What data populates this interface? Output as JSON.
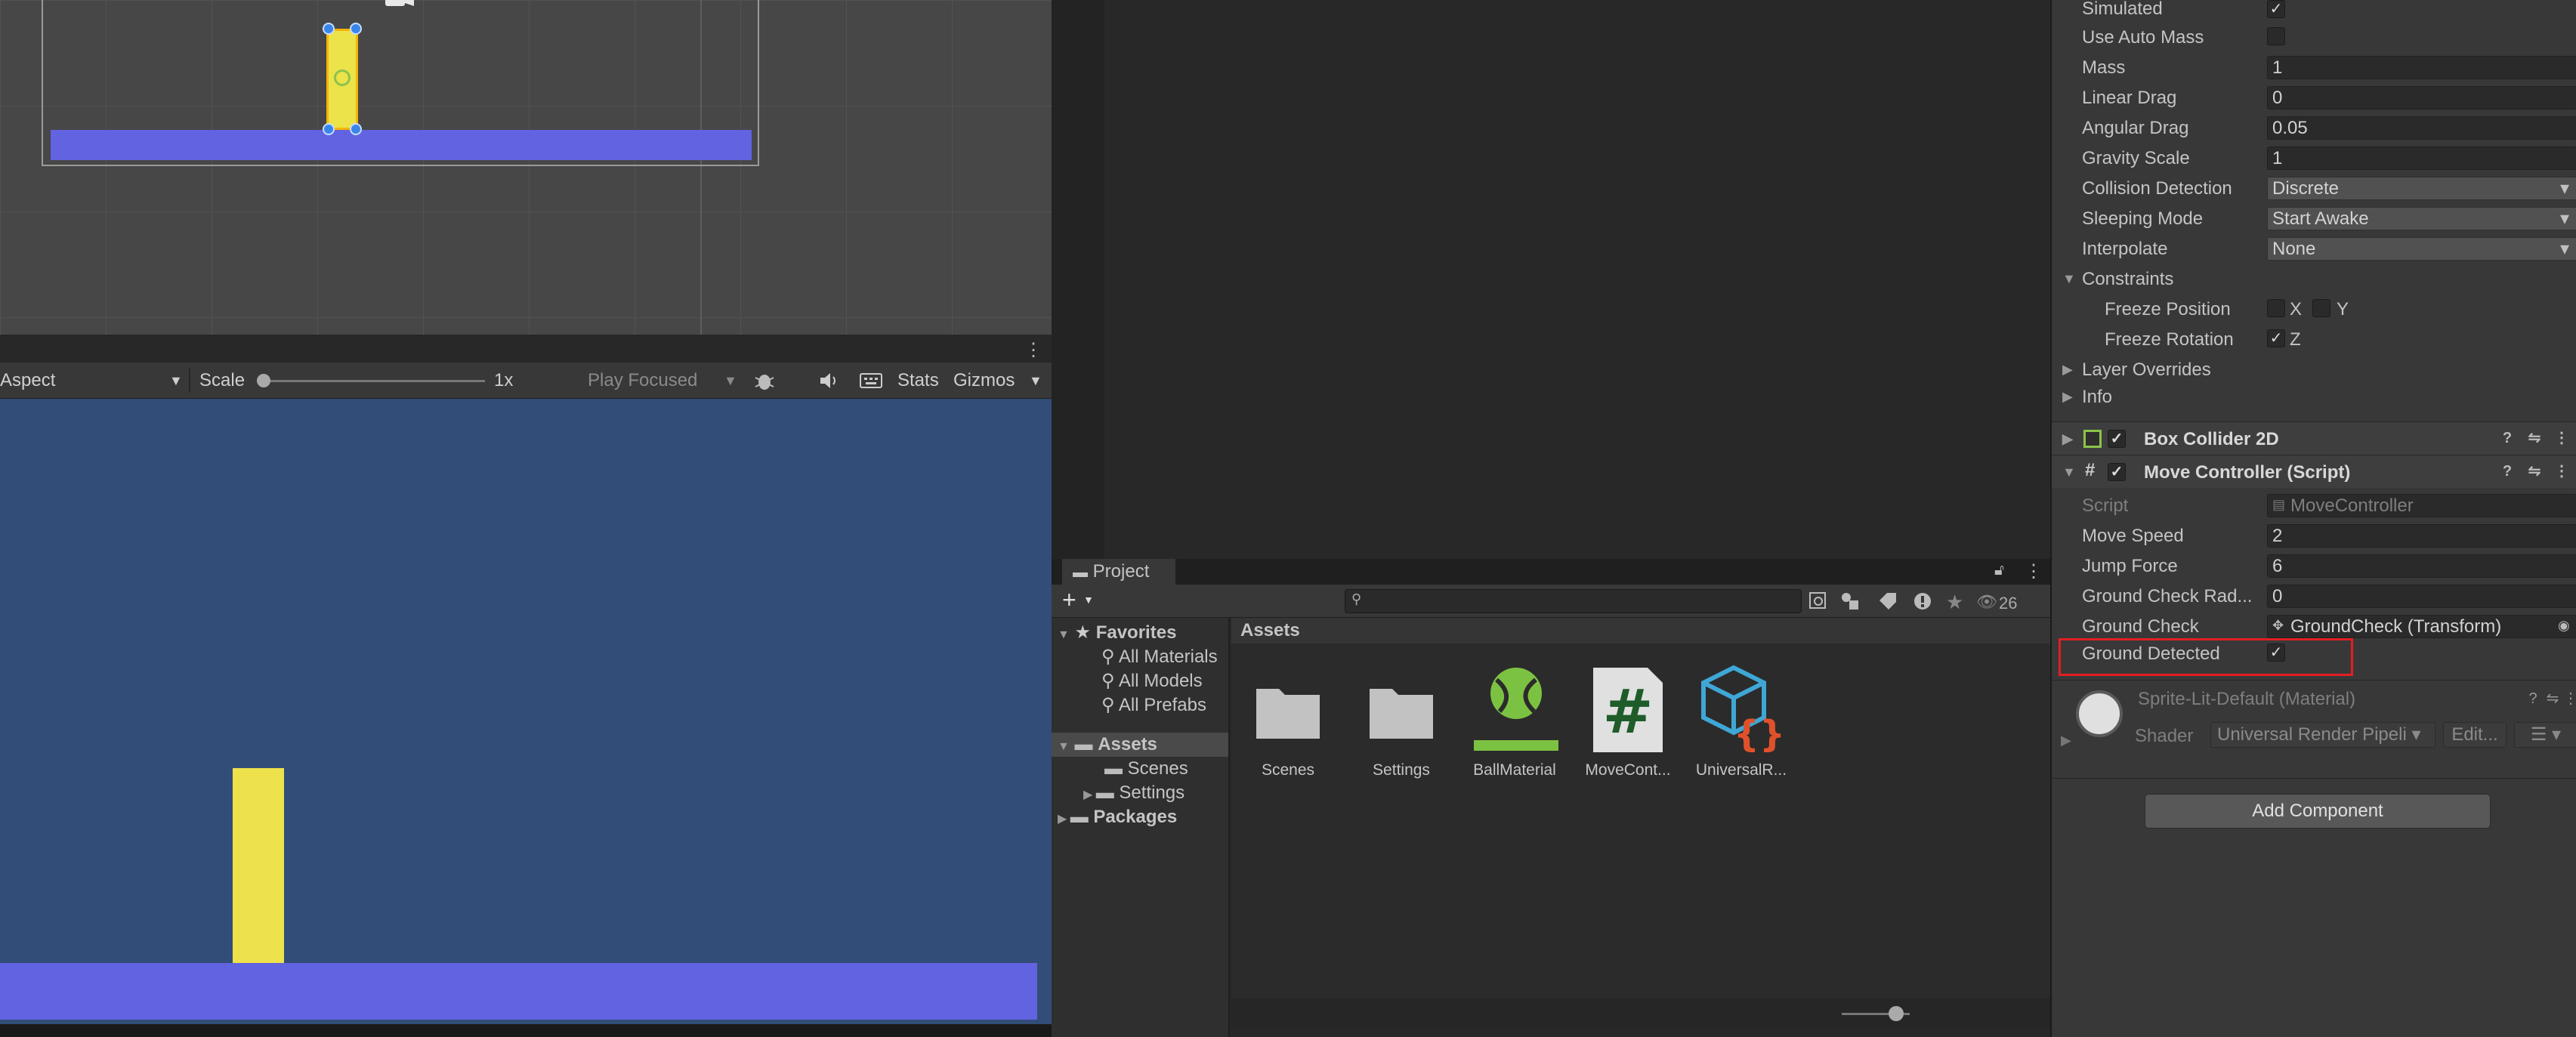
{
  "scene": {
    "camera_icon": "camera-icon"
  },
  "game_toolbar": {
    "aspect": "Aspect",
    "scale_label": "Scale",
    "scale_value": "1x",
    "play_mode": "Play Focused",
    "stats": "Stats",
    "gizmos": "Gizmos"
  },
  "project": {
    "tab": "Project",
    "count": "26",
    "tree": {
      "favorites": "Favorites",
      "all_materials": "All Materials",
      "all_models": "All Models",
      "all_prefabs": "All Prefabs",
      "assets": "Assets",
      "scenes": "Scenes",
      "settings": "Settings",
      "packages": "Packages"
    },
    "assets_header": "Assets",
    "items": [
      {
        "label": "Scenes",
        "icon": "folder-icon"
      },
      {
        "label": "Settings",
        "icon": "folder-icon"
      },
      {
        "label": "BallMaterial",
        "icon": "physics-material-icon"
      },
      {
        "label": "MoveCont...",
        "icon": "csharp-script-icon"
      },
      {
        "label": "UniversalR...",
        "icon": "package-cube-icon"
      }
    ]
  },
  "inspector": {
    "rigidbody": {
      "simulated": "Simulated",
      "use_auto_mass": "Use Auto Mass",
      "mass": "Mass",
      "mass_value": "1",
      "linear_drag": "Linear Drag",
      "linear_drag_value": "0",
      "angular_drag": "Angular Drag",
      "angular_drag_value": "0.05",
      "gravity_scale": "Gravity Scale",
      "gravity_scale_value": "1",
      "collision_detection": "Collision Detection",
      "collision_detection_value": "Discrete",
      "sleeping_mode": "Sleeping Mode",
      "sleeping_mode_value": "Start Awake",
      "interpolate": "Interpolate",
      "interpolate_value": "None",
      "constraints": "Constraints",
      "freeze_position": "Freeze Position",
      "x": "X",
      "y": "Y",
      "freeze_rotation": "Freeze Rotation",
      "z": "Z",
      "layer_overrides": "Layer Overrides",
      "info": "Info"
    },
    "box_collider": "Box Collider 2D",
    "move_controller": {
      "title": "Move Controller (Script)",
      "script": "Script",
      "script_value": "MoveController",
      "move_speed": "Move Speed",
      "move_speed_value": "2",
      "jump_force": "Jump Force",
      "jump_force_value": "6",
      "ground_check_radius": "Ground Check Rad...",
      "ground_check_radius_value": "0",
      "ground_check": "Ground Check",
      "ground_check_value": "GroundCheck (Transform)",
      "ground_detected": "Ground Detected"
    },
    "material": {
      "name": "Sprite-Lit-Default (Material)",
      "shader": "Shader",
      "shader_value": "Universal Render Pipeli",
      "edit": "Edit..."
    },
    "add_component": "Add Component"
  },
  "colors": {
    "highlight": "#e31e24",
    "game_bg": "#314d78",
    "ground": "#6163e0",
    "player": "#ede24b"
  }
}
